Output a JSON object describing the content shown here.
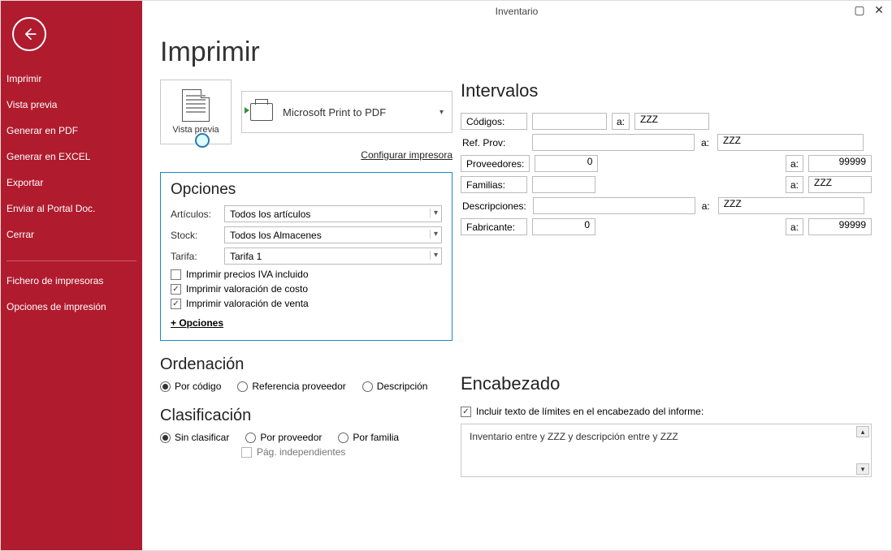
{
  "window": {
    "title": "Inventario"
  },
  "page_title": "Imprimir",
  "sidebar": {
    "items": [
      "Imprimir",
      "Vista previa",
      "Generar en PDF",
      "Generar en EXCEL",
      "Exportar",
      "Enviar al Portal Doc.",
      "Cerrar"
    ],
    "footer": [
      "Fichero de impresoras",
      "Opciones de impresión"
    ]
  },
  "vista_previa_label": "Vista previa",
  "printer_name": "Microsoft Print to PDF",
  "configure_link": "Configurar impresora",
  "opciones": {
    "title": "Opciones",
    "articulos_label": "Artículos:",
    "articulos_value": "Todos los artículos",
    "stock_label": "Stock:",
    "stock_value": "Todos los Almacenes",
    "tarifa_label": "Tarifa:",
    "tarifa_value": "Tarifa 1",
    "chk_iva": "Imprimir precios IVA incluido",
    "chk_costo": "Imprimir valoración de costo",
    "chk_venta": "Imprimir valoración de venta",
    "more": "+ Opciones"
  },
  "ordenacion": {
    "title": "Ordenación",
    "r1": "Por código",
    "r2": "Referencia proveedor",
    "r3": "Descripción"
  },
  "clasificacion": {
    "title": "Clasificación",
    "r1": "Sin clasificar",
    "r2": "Por proveedor",
    "r3": "Por familia",
    "pag_indep": "Pág. independientes"
  },
  "intervalos": {
    "title": "Intervalos",
    "a": "a:",
    "codigos": "Códigos:",
    "codigos_from": "",
    "codigos_to": "ZZZ",
    "refprov": "Ref. Prov:",
    "refprov_from": "",
    "refprov_to": "ZZZ",
    "proveedores": "Proveedores:",
    "proveedores_from": "0",
    "proveedores_to": "99999",
    "familias": "Familias:",
    "familias_from": "",
    "familias_to": "ZZZ",
    "descripciones": "Descripciones:",
    "descripciones_from": "",
    "descripciones_to": "ZZZ",
    "fabricante": "Fabricante:",
    "fabricante_from": "0",
    "fabricante_to": "99999"
  },
  "encabezado": {
    "title": "Encabezado",
    "chk": "Incluir texto de límites en el encabezado del informe:",
    "text": "Inventario entre  y ZZZ y descripción entre  y ZZZ"
  }
}
